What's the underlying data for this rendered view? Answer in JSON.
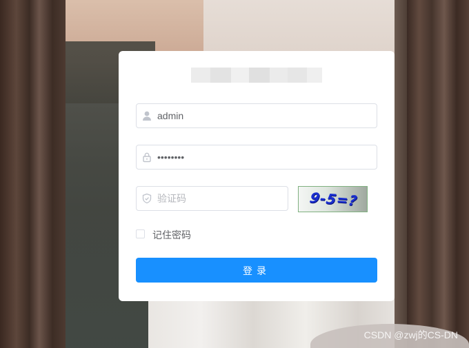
{
  "login": {
    "username": {
      "value": "admin",
      "icon": "user-icon"
    },
    "password": {
      "value": "••••••••",
      "icon": "lock-icon"
    },
    "captcha_input": {
      "placeholder": "验证码",
      "icon": "shield-icon"
    },
    "captcha_image_text": "9-5=?",
    "remember_label": "记住密码",
    "remember_checked": false,
    "submit_label": "登录"
  },
  "colors": {
    "primary": "#1890ff",
    "border": "#dcdfe6",
    "text": "#606266",
    "placeholder": "#b5b7bc"
  },
  "watermark": "CSDN @zwj的CS-DN"
}
